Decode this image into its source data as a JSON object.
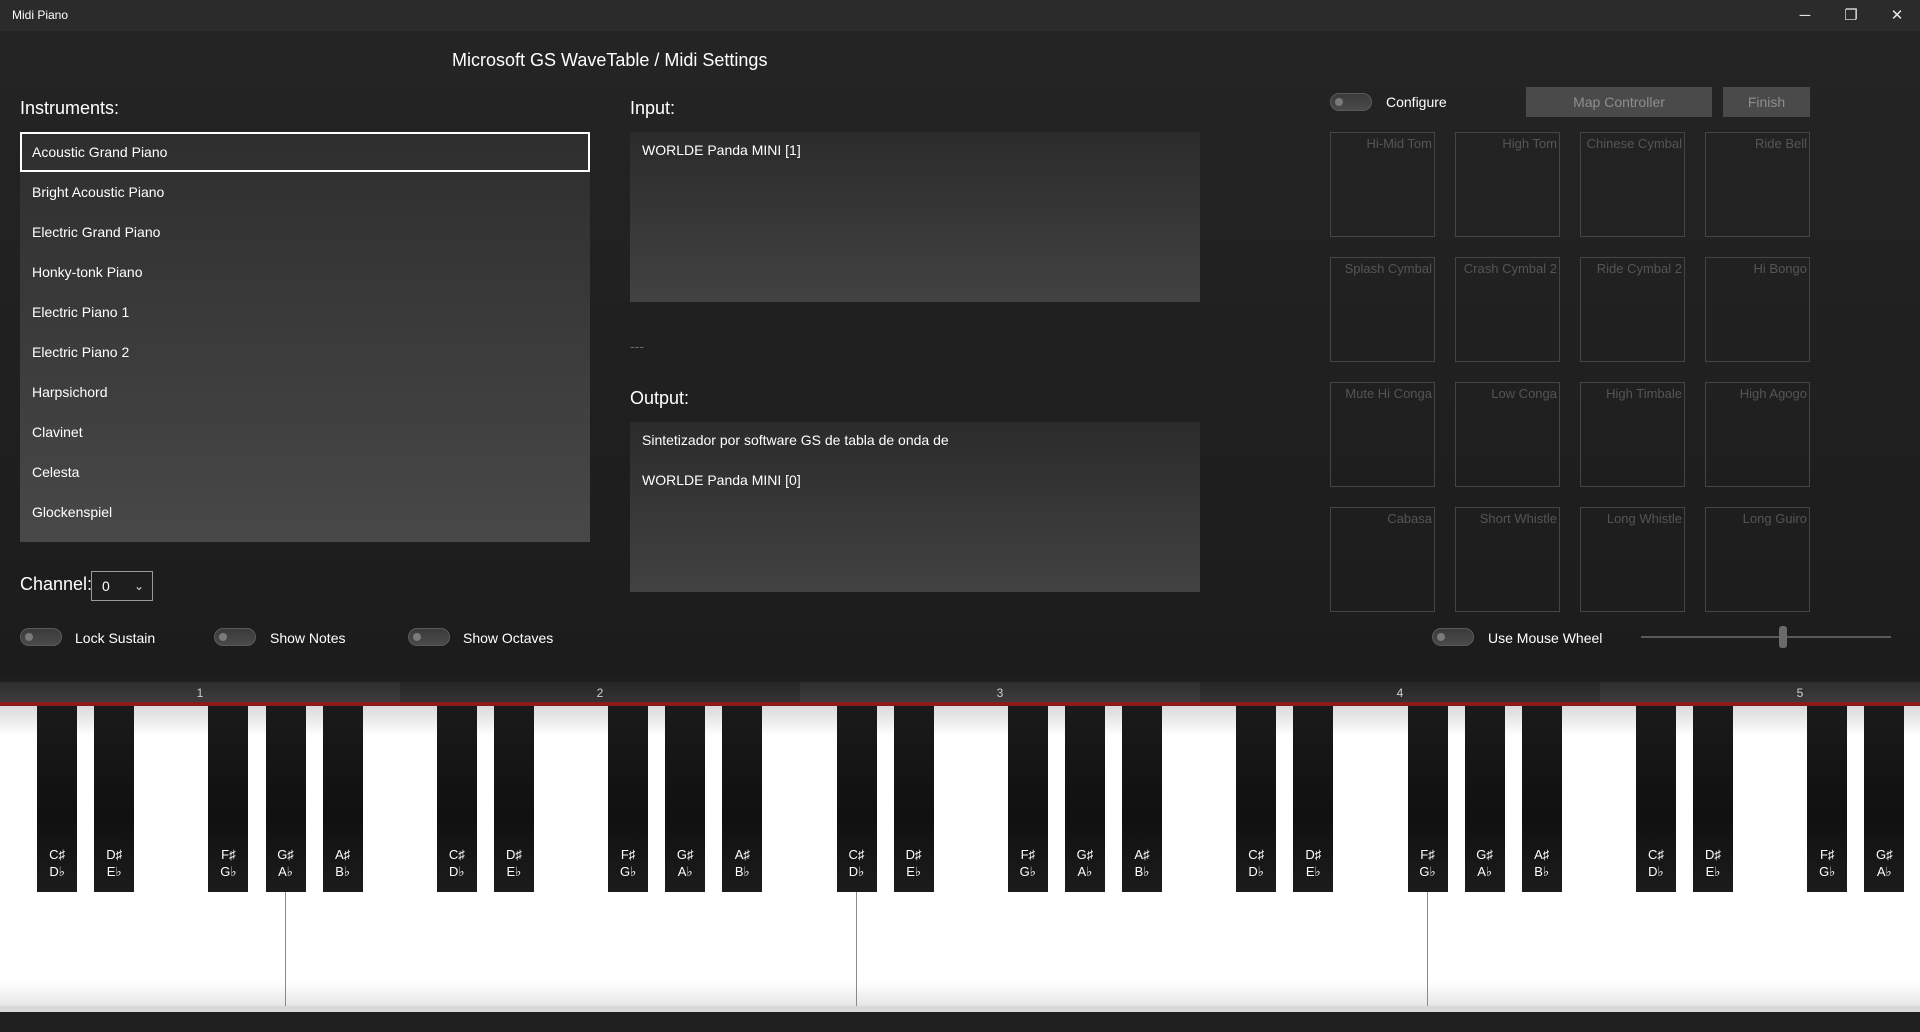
{
  "window": {
    "title": "Midi Piano",
    "controls": [
      "─",
      "❐",
      "✕"
    ]
  },
  "header": {
    "title": "Microsoft GS WaveTable / Midi Settings"
  },
  "instruments": {
    "label": "Instruments:",
    "selected_index": 0,
    "items": [
      "Acoustic Grand Piano",
      "Bright Acoustic Piano",
      "Electric Grand Piano",
      "Honky-tonk Piano",
      "Electric Piano 1",
      "Electric Piano 2",
      "Harpsichord",
      "Clavinet",
      "Celesta",
      "Glockenspiel"
    ]
  },
  "input": {
    "label": "Input:",
    "items": [
      "WORLDE Panda MINI [1]"
    ]
  },
  "separator": "---",
  "output": {
    "label": "Output:",
    "items": [
      "Sintetizador por software GS de tabla de onda de",
      "WORLDE Panda MINI [0]"
    ]
  },
  "channel": {
    "label": "Channel:",
    "value": "0"
  },
  "toggles": {
    "lock_sustain": "Lock Sustain",
    "show_notes": "Show Notes",
    "show_octaves": "Show Octaves",
    "configure": "Configure",
    "use_mouse_wheel": "Use Mouse Wheel"
  },
  "buttons": {
    "map_controller": "Map Controller",
    "finish": "Finish"
  },
  "pads": [
    "Hi-Mid Tom",
    "High Tom",
    "Chinese Cymbal",
    "Ride Bell",
    "Splash Cymbal",
    "Crash Cymbal 2",
    "Ride Cymbal 2",
    "Hi Bongo",
    "Mute Hi Conga",
    "Low Conga",
    "High Timbale",
    "High Agogo",
    "Cabasa",
    "Short Whistle",
    "Long Whistle",
    "Long Guiro"
  ],
  "octaves": [
    "1",
    "2",
    "3",
    "4",
    "5"
  ],
  "black_key_labels": [
    {
      "sharp": "C♯",
      "flat": "D♭"
    },
    {
      "sharp": "D♯",
      "flat": "E♭"
    },
    {
      "sharp": "F♯",
      "flat": "G♭"
    },
    {
      "sharp": "G♯",
      "flat": "A♭"
    },
    {
      "sharp": "A♯",
      "flat": "B♭"
    }
  ],
  "mouse_wheel_slider": {
    "value_fraction": 0.57
  }
}
